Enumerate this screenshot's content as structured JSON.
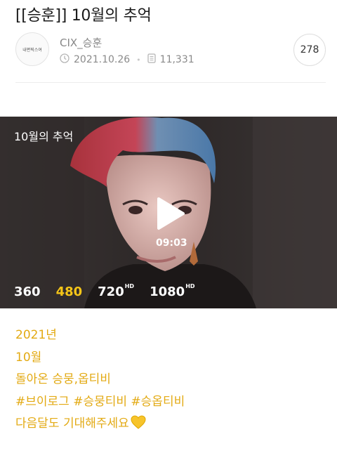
{
  "post": {
    "title": "[[승훈]] 10월의 추억",
    "author": "CIX_승훈",
    "avatar_text": "내편픽스여",
    "date": "2021.10.26",
    "views": "11,331",
    "comment_count": "278"
  },
  "video": {
    "overlay_title": "10월의 추억",
    "duration": "09:03",
    "qualities": [
      {
        "label": "360",
        "badge": ""
      },
      {
        "label": "480",
        "badge": ""
      },
      {
        "label": "720",
        "badge": "HD"
      },
      {
        "label": "1080",
        "badge": "HD"
      }
    ],
    "active_quality": "480"
  },
  "body": {
    "lines": [
      "2021년",
      "10월",
      "돌아온 승뭉,옵티비",
      "#브이로그 #승뭉티비 #승옵티비",
      "다음달도 기대해주세요"
    ],
    "emoji": "yellow-heart-icon"
  },
  "colors": {
    "accent": "#e3aa13",
    "active_quality": "#f5c518"
  }
}
